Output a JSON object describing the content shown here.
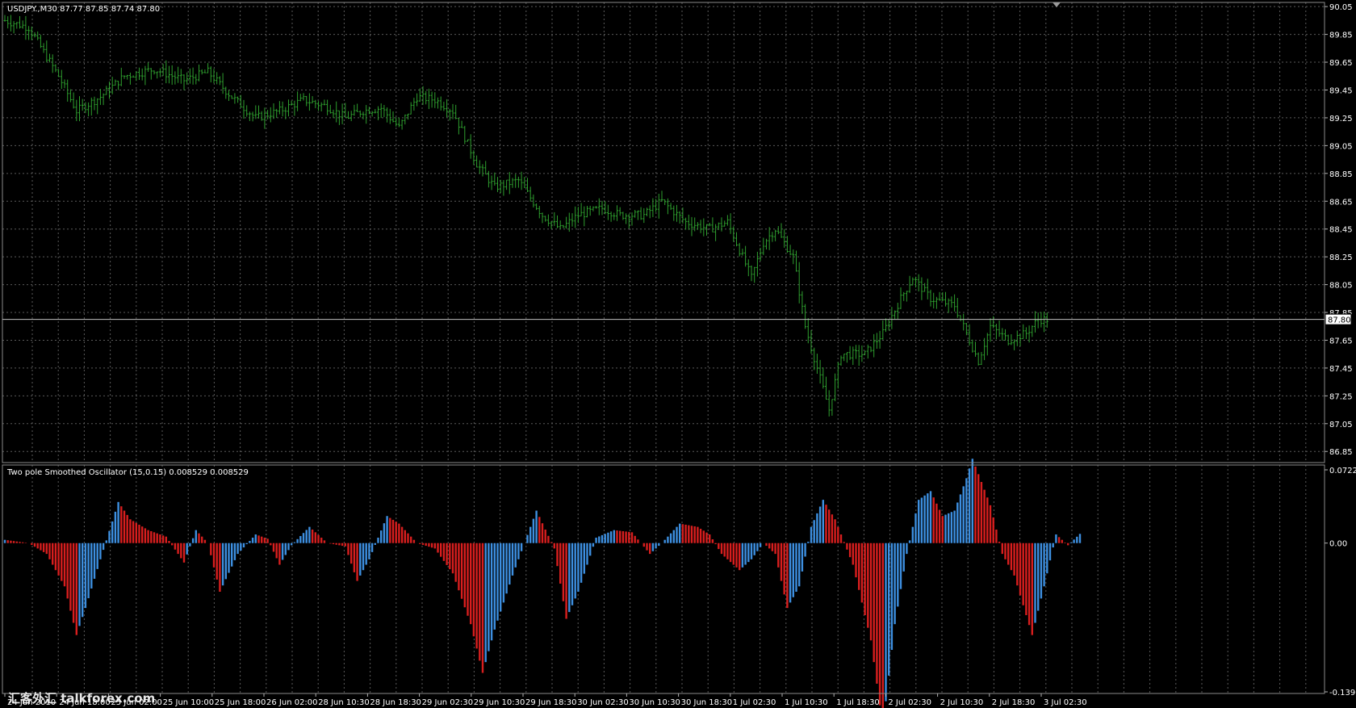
{
  "main_panel": {
    "info_label": "USDJPY.,M30  87.77 87.85 87.74 87.80",
    "current_price_label": "87.80"
  },
  "osc_panel": {
    "info_label": "Two pole Smoothed Oscillator (15,0.15) 0.008529 0.008529"
  },
  "watermark": "汇客外汇 talkforex.com",
  "colors": {
    "background": "#000000",
    "price_bars": "#2e9e2e",
    "grid": "#5a5a5a",
    "osc_up": "#3d8fe0",
    "osc_down": "#d81e1e",
    "axis_text": "#ffffff",
    "price_line": "#c0c0c0"
  },
  "chart_data": [
    {
      "type": "ohlc-bar",
      "symbol": "USDJPY",
      "timeframe": "M30",
      "last_ohlc": {
        "open": 87.77,
        "high": 87.85,
        "low": 87.74,
        "close": 87.8
      },
      "current_price": 87.8,
      "ylim": [
        86.77,
        90.08
      ],
      "y_ticks": [
        "90.05",
        "89.85",
        "89.65",
        "89.45",
        "89.25",
        "89.05",
        "88.85",
        "88.65",
        "88.45",
        "88.25",
        "88.05",
        "87.85",
        "87.65",
        "87.45",
        "87.25",
        "87.05",
        "86.85"
      ],
      "close_path": [
        [
          0,
          89.95
        ],
        [
          8,
          89.9
        ],
        [
          18,
          89.55
        ],
        [
          24,
          89.3
        ],
        [
          32,
          89.4
        ],
        [
          40,
          89.55
        ],
        [
          50,
          89.6
        ],
        [
          60,
          89.52
        ],
        [
          68,
          89.58
        ],
        [
          76,
          89.4
        ],
        [
          84,
          89.25
        ],
        [
          92,
          89.3
        ],
        [
          100,
          89.38
        ],
        [
          108,
          89.33
        ],
        [
          114,
          89.25
        ],
        [
          120,
          89.3
        ],
        [
          126,
          89.32
        ],
        [
          132,
          89.18
        ],
        [
          138,
          89.4
        ],
        [
          144,
          89.38
        ],
        [
          150,
          89.3
        ],
        [
          158,
          88.92
        ],
        [
          164,
          88.75
        ],
        [
          172,
          88.8
        ],
        [
          180,
          88.55
        ],
        [
          186,
          88.45
        ],
        [
          192,
          88.55
        ],
        [
          200,
          88.6
        ],
        [
          206,
          88.55
        ],
        [
          214,
          88.55
        ],
        [
          220,
          88.65
        ],
        [
          228,
          88.5
        ],
        [
          236,
          88.45
        ],
        [
          242,
          88.5
        ],
        [
          246,
          88.3
        ],
        [
          250,
          88.1
        ],
        [
          254,
          88.35
        ],
        [
          258,
          88.45
        ],
        [
          264,
          88.25
        ],
        [
          268,
          87.75
        ],
        [
          272,
          87.45
        ],
        [
          276,
          87.15
        ],
        [
          280,
          87.55
        ],
        [
          288,
          87.55
        ],
        [
          294,
          87.7
        ],
        [
          300,
          87.95
        ],
        [
          304,
          88.1
        ],
        [
          310,
          87.95
        ],
        [
          318,
          87.9
        ],
        [
          322,
          87.7
        ],
        [
          326,
          87.5
        ],
        [
          330,
          87.75
        ],
        [
          336,
          87.65
        ],
        [
          342,
          87.7
        ],
        [
          346,
          87.8
        ]
      ],
      "x_ticks": [
        "24 Jun 2010",
        "24 Jun 18:00",
        "25 Jun 02:00",
        "25 Jun 10:00",
        "25 Jun 18:00",
        "26 Jun 02:00",
        "28 Jun 10:30",
        "28 Jun 18:30",
        "29 Jun 02:30",
        "29 Jun 10:30",
        "29 Jun 18:30",
        "30 Jun 02:30",
        "30 Jun 10:30",
        "30 Jun 18:30",
        "1 Jul 02:30",
        "1 Jul 10:30",
        "1 Jul 18:30",
        "2 Jul 02:30",
        "2 Jul 10:30",
        "2 Jul 18:30",
        "3 Jul 02:30"
      ]
    },
    {
      "type": "histogram",
      "name": "Two pole Smoothed Oscillator (15,0.15)",
      "values_shown": [
        0.008529,
        0.008529
      ],
      "ylim": [
        -0.13906,
        0.072201
      ],
      "y_ticks": [
        "0.072201",
        "0.00",
        "-0.139060"
      ],
      "oscillator_path": [
        [
          0,
          0.003
        ],
        [
          8,
          0.0
        ],
        [
          14,
          -0.01
        ],
        [
          20,
          -0.04
        ],
        [
          24,
          -0.085
        ],
        [
          27,
          -0.06
        ],
        [
          32,
          -0.015
        ],
        [
          36,
          0.02
        ],
        [
          38,
          0.038
        ],
        [
          42,
          0.022
        ],
        [
          48,
          0.012
        ],
        [
          54,
          0.006
        ],
        [
          60,
          -0.018
        ],
        [
          64,
          0.012
        ],
        [
          68,
          0.0
        ],
        [
          72,
          -0.045
        ],
        [
          78,
          -0.01
        ],
        [
          84,
          0.008
        ],
        [
          88,
          0.004
        ],
        [
          92,
          -0.02
        ],
        [
          96,
          -0.002
        ],
        [
          102,
          0.015
        ],
        [
          108,
          0.0
        ],
        [
          114,
          -0.003
        ],
        [
          118,
          -0.035
        ],
        [
          122,
          -0.015
        ],
        [
          128,
          0.025
        ],
        [
          132,
          0.018
        ],
        [
          138,
          0.0
        ],
        [
          144,
          -0.005
        ],
        [
          150,
          -0.028
        ],
        [
          156,
          -0.075
        ],
        [
          160,
          -0.12
        ],
        [
          164,
          -0.08
        ],
        [
          170,
          -0.03
        ],
        [
          176,
          0.015
        ],
        [
          178,
          0.03
        ],
        [
          184,
          -0.005
        ],
        [
          188,
          -0.07
        ],
        [
          192,
          -0.045
        ],
        [
          198,
          0.005
        ],
        [
          204,
          0.012
        ],
        [
          210,
          0.01
        ],
        [
          216,
          -0.01
        ],
        [
          220,
          0.0
        ],
        [
          226,
          0.018
        ],
        [
          232,
          0.015
        ],
        [
          236,
          0.008
        ],
        [
          240,
          -0.01
        ],
        [
          246,
          -0.025
        ],
        [
          250,
          -0.015
        ],
        [
          254,
          0.0
        ],
        [
          258,
          -0.01
        ],
        [
          262,
          -0.06
        ],
        [
          266,
          -0.04
        ],
        [
          270,
          0.015
        ],
        [
          274,
          0.04
        ],
        [
          278,
          0.022
        ],
        [
          284,
          -0.02
        ],
        [
          290,
          -0.09
        ],
        [
          294,
          -0.17
        ],
        [
          298,
          -0.075
        ],
        [
          302,
          -0.01
        ],
        [
          306,
          0.04
        ],
        [
          310,
          0.048
        ],
        [
          314,
          0.025
        ],
        [
          318,
          0.03
        ],
        [
          322,
          0.06
        ],
        [
          324,
          0.078
        ],
        [
          330,
          0.035
        ],
        [
          334,
          -0.01
        ],
        [
          338,
          -0.03
        ],
        [
          344,
          -0.085
        ],
        [
          348,
          -0.04
        ],
        [
          352,
          0.008
        ],
        [
          356,
          -0.002
        ],
        [
          360,
          0.008529
        ]
      ],
      "up_color": "#3d8fe0",
      "down_color": "#d81e1e"
    }
  ]
}
